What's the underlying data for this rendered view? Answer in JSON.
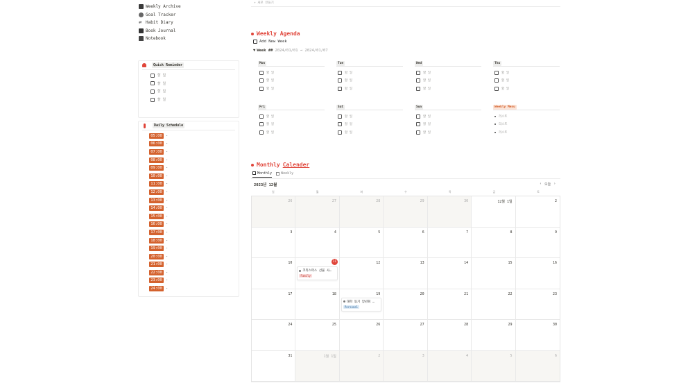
{
  "nav": [
    {
      "label": "Weekly Archive",
      "icon": "archive-icon"
    },
    {
      "label": "Goal Tracker",
      "icon": "target-icon"
    },
    {
      "label": "Habit Diary",
      "icon": "repeat-icon"
    },
    {
      "label": "Book Journal",
      "icon": "book-icon"
    },
    {
      "label": "Notebook",
      "icon": "folder-icon"
    }
  ],
  "reminder": {
    "title": "Quick Reminder",
    "items": [
      "할 일",
      "할 일",
      "할 일",
      "할 일"
    ]
  },
  "schedule": {
    "title": "Daily Schedule",
    "dash": "-",
    "times": [
      "05:00",
      "06:00",
      "07:00",
      "08:00",
      "09:00",
      "10:00",
      "11:00",
      "12:00",
      "13:00",
      "14:00",
      "15:00",
      "16:00",
      "17:00",
      "18:00",
      "19:00",
      "20:00",
      "21:00",
      "22:00",
      "23:00",
      "24:00"
    ]
  },
  "topbar": {
    "hint": "+ 새로 만들기"
  },
  "agenda": {
    "title": "Weekly Agenda",
    "add_label": "Add New Week",
    "week_label": "Week ##",
    "week_dates": "2024/01/01 → 2024/01/07",
    "days": [
      {
        "name": "Mon",
        "items": [
          "할 일",
          "할 일",
          "할 일"
        ]
      },
      {
        "name": "Tue",
        "items": [
          "할 일",
          "할 일",
          "할 일"
        ]
      },
      {
        "name": "Wed",
        "items": [
          "할 일",
          "할 일",
          "할 일"
        ]
      },
      {
        "name": "Thu",
        "items": [
          "할 일",
          "할 일",
          "할 일"
        ]
      },
      {
        "name": "Fri",
        "items": [
          "할 일",
          "할 일",
          "할 일"
        ]
      },
      {
        "name": "Sat",
        "items": [
          "할 일",
          "할 일",
          "할 일"
        ]
      },
      {
        "name": "Sun",
        "items": [
          "할 일",
          "할 일",
          "할 일"
        ]
      }
    ],
    "menu": {
      "name": "Weekly Menu",
      "items": [
        "리스트",
        "리스트",
        "리스트"
      ]
    }
  },
  "calendar": {
    "title_a": "Monthly",
    "title_b": "Calender",
    "tabs": [
      "Monthly",
      "Weekly"
    ],
    "month": "2023년 12월",
    "today_label": "오늘",
    "prev": "‹",
    "next": "›",
    "weekdays": [
      "일",
      "월",
      "화",
      "수",
      "목",
      "금",
      "토"
    ],
    "cells": [
      "26",
      "27",
      "28",
      "29",
      "30",
      "12월 1일",
      "2",
      "3",
      "4",
      "5",
      "6",
      "7",
      "8",
      "9",
      "10",
      "11",
      "12",
      "13",
      "14",
      "15",
      "16",
      "17",
      "18",
      "19",
      "20",
      "21",
      "22",
      "23",
      "24",
      "25",
      "26",
      "27",
      "28",
      "29",
      "30",
      "31",
      "1월 1일",
      "2",
      "3",
      "4",
      "5",
      "6"
    ],
    "events": [
      {
        "title": "크리스마스 선물 사…",
        "tag": "Family"
      },
      {
        "title": "대학 동기 망년회 …",
        "tag": "Personal"
      }
    ],
    "colors": {
      "accent": "#e0453a",
      "time_badge": "#d4622e"
    }
  }
}
